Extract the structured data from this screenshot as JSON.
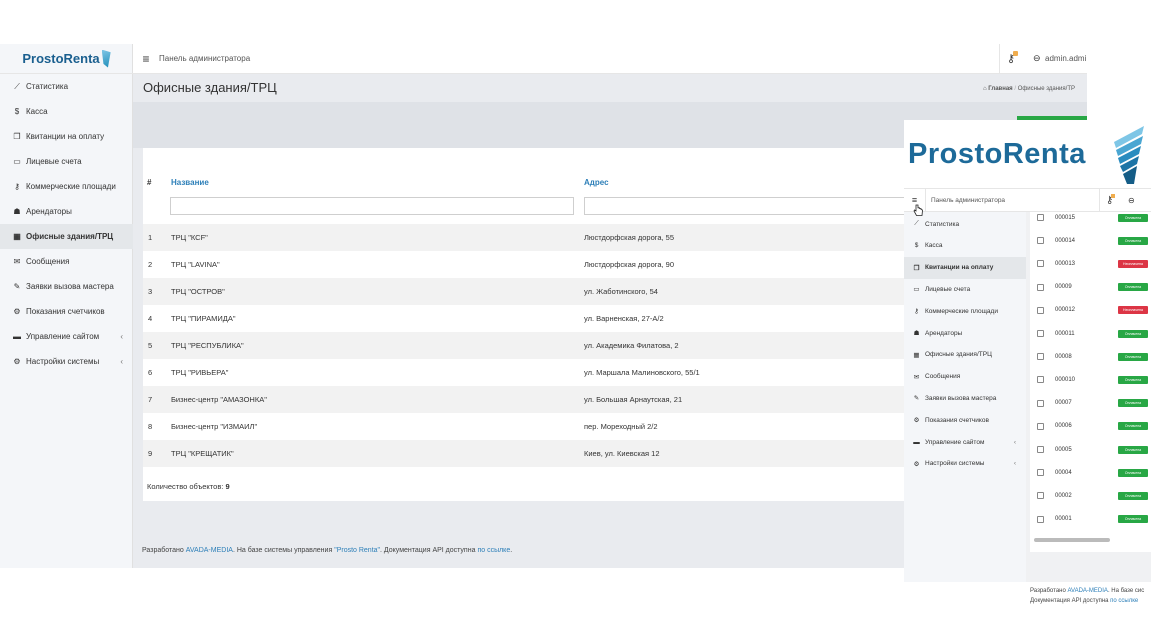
{
  "sidebar": {
    "logo": "ProstoRenta",
    "items": [
      {
        "icon": "chart-line-icon",
        "glyph": "⟋",
        "label": "Статистика"
      },
      {
        "icon": "dollar-icon",
        "glyph": "$",
        "label": "Касса"
      },
      {
        "icon": "receipt-icon",
        "glyph": "❐",
        "label": "Квитанции на оплату"
      },
      {
        "icon": "id-card-icon",
        "glyph": "▭",
        "label": "Лицевые счета"
      },
      {
        "icon": "key-icon",
        "glyph": "⚷",
        "label": "Коммерческие площади"
      },
      {
        "icon": "users-icon",
        "glyph": "☗",
        "label": "Арендаторы"
      },
      {
        "icon": "building-icon",
        "glyph": "▦",
        "label": "Офисные здания/ТРЦ"
      },
      {
        "icon": "envelope-icon",
        "glyph": "✉",
        "label": "Сообщения"
      },
      {
        "icon": "wrench-icon",
        "glyph": "✎",
        "label": "Заявки вызова мастера"
      },
      {
        "icon": "meter-icon",
        "glyph": "⚙",
        "label": "Показания счетчиков"
      },
      {
        "icon": "monitor-icon",
        "glyph": "▬",
        "label": "Управление сайтом"
      },
      {
        "icon": "cogs-icon",
        "glyph": "⚙",
        "label": "Настройки системы"
      }
    ]
  },
  "topbar": {
    "menu_glyph": "≡",
    "title": "Панель администратора",
    "user": "admin.admi",
    "key_glyph": "⚷",
    "user_glyph": "⊖"
  },
  "page": {
    "title": "Офисные здания/ТРЦ",
    "breadcrumb_home": "Главная",
    "breadcrumb_sep": "/",
    "breadcrumb_current": "Офисные здания/ТР",
    "home_glyph": "⌂"
  },
  "table": {
    "headers": {
      "num": "#",
      "name": "Название",
      "address": "Адрес"
    },
    "rows": [
      {
        "num": "1",
        "name": "ТРЦ \"КСF\"",
        "address": "Люстдорфская дорога, 55"
      },
      {
        "num": "2",
        "name": "ТРЦ \"LAVINA\"",
        "address": "Люстдорфская дорога, 90"
      },
      {
        "num": "3",
        "name": "ТРЦ \"ОСТРОВ\"",
        "address": "ул. Жаботинского, 54"
      },
      {
        "num": "4",
        "name": "ТРЦ \"ПИРАМИДА\"",
        "address": "ул. Варненская, 27-А/2"
      },
      {
        "num": "5",
        "name": "ТРЦ \"РЕСПУБЛИКА\"",
        "address": "ул. Академика Филатова, 2"
      },
      {
        "num": "6",
        "name": "ТРЦ \"РИВЬЕРА\"",
        "address": "ул. Маршала Малиновского, 55/1"
      },
      {
        "num": "7",
        "name": "Бизнес-центр \"АМАЗОНКА\"",
        "address": "ул. Большая Арнаутская, 21"
      },
      {
        "num": "8",
        "name": "Бизнес-центр \"ИЗМАИЛ\"",
        "address": "пер. Мореходный 2/2"
      },
      {
        "num": "9",
        "name": "ТРЦ \"КРЕЩАТИК\"",
        "address": "Киев, ул. Киевская 12"
      }
    ],
    "count_label": "Количество объектов:",
    "count_value": "9"
  },
  "footer": {
    "prefix": "Разработано",
    "dev": "AVADA-MEDIA",
    "middle": ". На базе системы управления",
    "product": "\"Prosto Renta\"",
    "api_text": ". Документация API доступна",
    "api_link": "по ссылке",
    "end": "."
  },
  "overlay": {
    "logo": "ProstoRenta",
    "topbar_title": "Панель администратора",
    "menu_glyph": "≡",
    "items": [
      {
        "icon": "chart-line-icon",
        "glyph": "⟋",
        "label": "Статистика"
      },
      {
        "icon": "dollar-icon",
        "glyph": "$",
        "label": "Касса"
      },
      {
        "icon": "receipt-icon",
        "glyph": "❐",
        "label": "Квитанции на оплату"
      },
      {
        "icon": "id-card-icon",
        "glyph": "▭",
        "label": "Лицевые счета"
      },
      {
        "icon": "key-icon",
        "glyph": "⚷",
        "label": "Коммерческие площади"
      },
      {
        "icon": "users-icon",
        "glyph": "☗",
        "label": "Арендаторы"
      },
      {
        "icon": "building-icon",
        "glyph": "▦",
        "label": "Офисные здания/ТРЦ"
      },
      {
        "icon": "envelope-icon",
        "glyph": "✉",
        "label": "Сообщения"
      },
      {
        "icon": "wrench-icon",
        "glyph": "✎",
        "label": "Заявки вызова мастера"
      },
      {
        "icon": "meter-icon",
        "glyph": "⚙",
        "label": "Показания счетчиков"
      },
      {
        "icon": "monitor-icon",
        "glyph": "▬",
        "label": "Управление сайтом"
      },
      {
        "icon": "cogs-icon",
        "glyph": "⚙",
        "label": "Настройки системы"
      }
    ],
    "receipts": [
      {
        "num": "000015",
        "status": "Оплачена",
        "paid": true
      },
      {
        "num": "000014",
        "status": "Оплачена",
        "paid": true
      },
      {
        "num": "000013",
        "status": "Неоплачена",
        "paid": false
      },
      {
        "num": "00009",
        "status": "Оплачена",
        "paid": true
      },
      {
        "num": "000012",
        "status": "Неоплачена",
        "paid": false
      },
      {
        "num": "000011",
        "status": "Оплачена",
        "paid": true
      },
      {
        "num": "00008",
        "status": "Оплачена",
        "paid": true
      },
      {
        "num": "000010",
        "status": "Оплачена",
        "paid": true
      },
      {
        "num": "00007",
        "status": "Оплачена",
        "paid": true
      },
      {
        "num": "00006",
        "status": "Оплачена",
        "paid": true
      },
      {
        "num": "00005",
        "status": "Оплачена",
        "paid": true
      },
      {
        "num": "00004",
        "status": "Оплачена",
        "paid": true
      },
      {
        "num": "00002",
        "status": "Оплачена",
        "paid": true
      },
      {
        "num": "00001",
        "status": "Оплачена",
        "paid": true
      }
    ],
    "footer_line1": "Разработано",
    "footer_dev": "AVADA-MEDIA",
    "footer_line1_end": ". На базе сис",
    "footer_line2": "Документация API доступна",
    "footer_link": "по ссылке"
  },
  "colors": {
    "accent": "#2d7fb8",
    "green": "#28a745",
    "red": "#dc3545",
    "logo": "#1d6a99"
  }
}
